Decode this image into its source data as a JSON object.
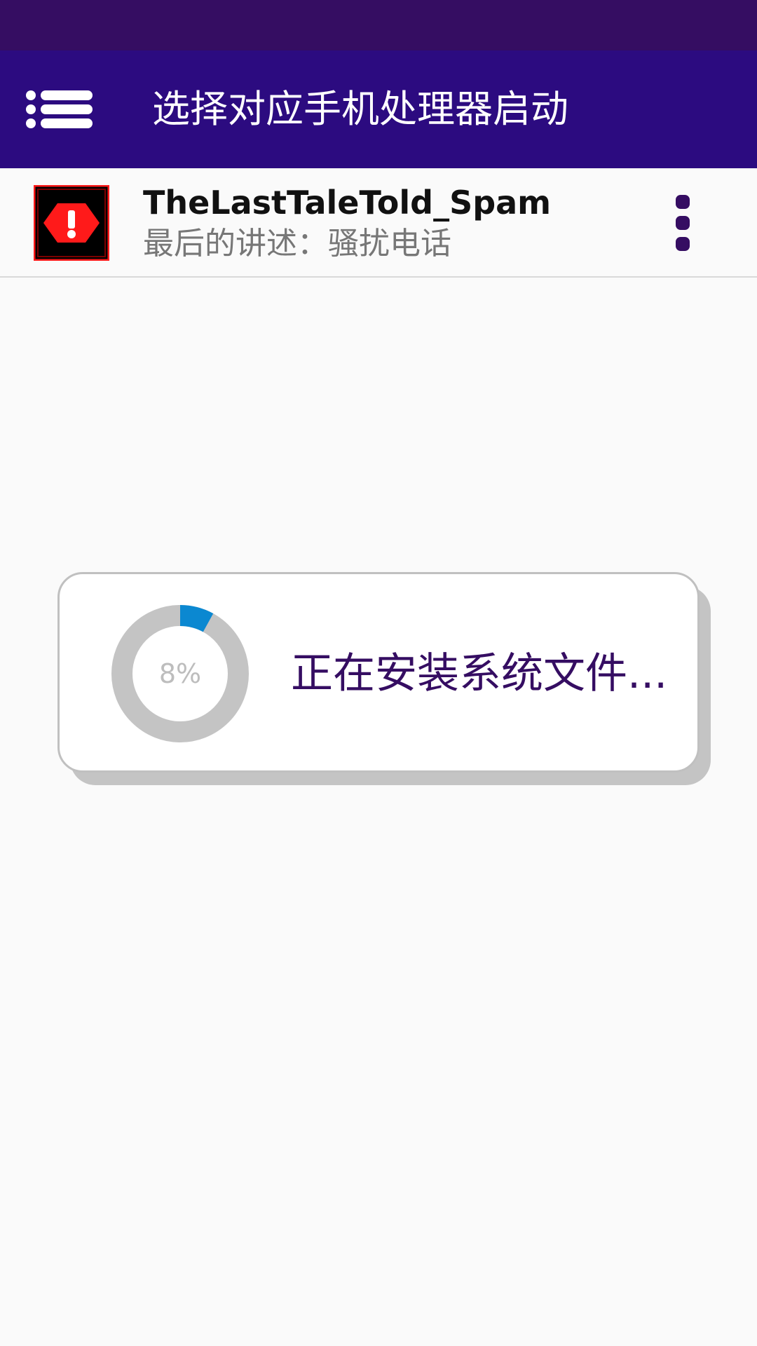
{
  "colors": {
    "status_bar": "#350d62",
    "app_bar": "#2c0b80",
    "accent_purple": "#350d62",
    "progress_fill": "#0b88d1",
    "progress_track": "#c4c4c4",
    "warning_red": "#ff1a1a"
  },
  "header": {
    "menu_icon": "list-menu-icon",
    "title": "选择对应手机处理器启动"
  },
  "app": {
    "icon": "warning-hexagon-icon",
    "name": "TheLastTaleTold_Spam",
    "subtitle": "最后的讲述：骚扰电话",
    "menu_icon": "more-vertical-icon"
  },
  "dialog": {
    "progress_percent": 8,
    "progress_label": "8%",
    "message": "正在安装系统文件..."
  }
}
